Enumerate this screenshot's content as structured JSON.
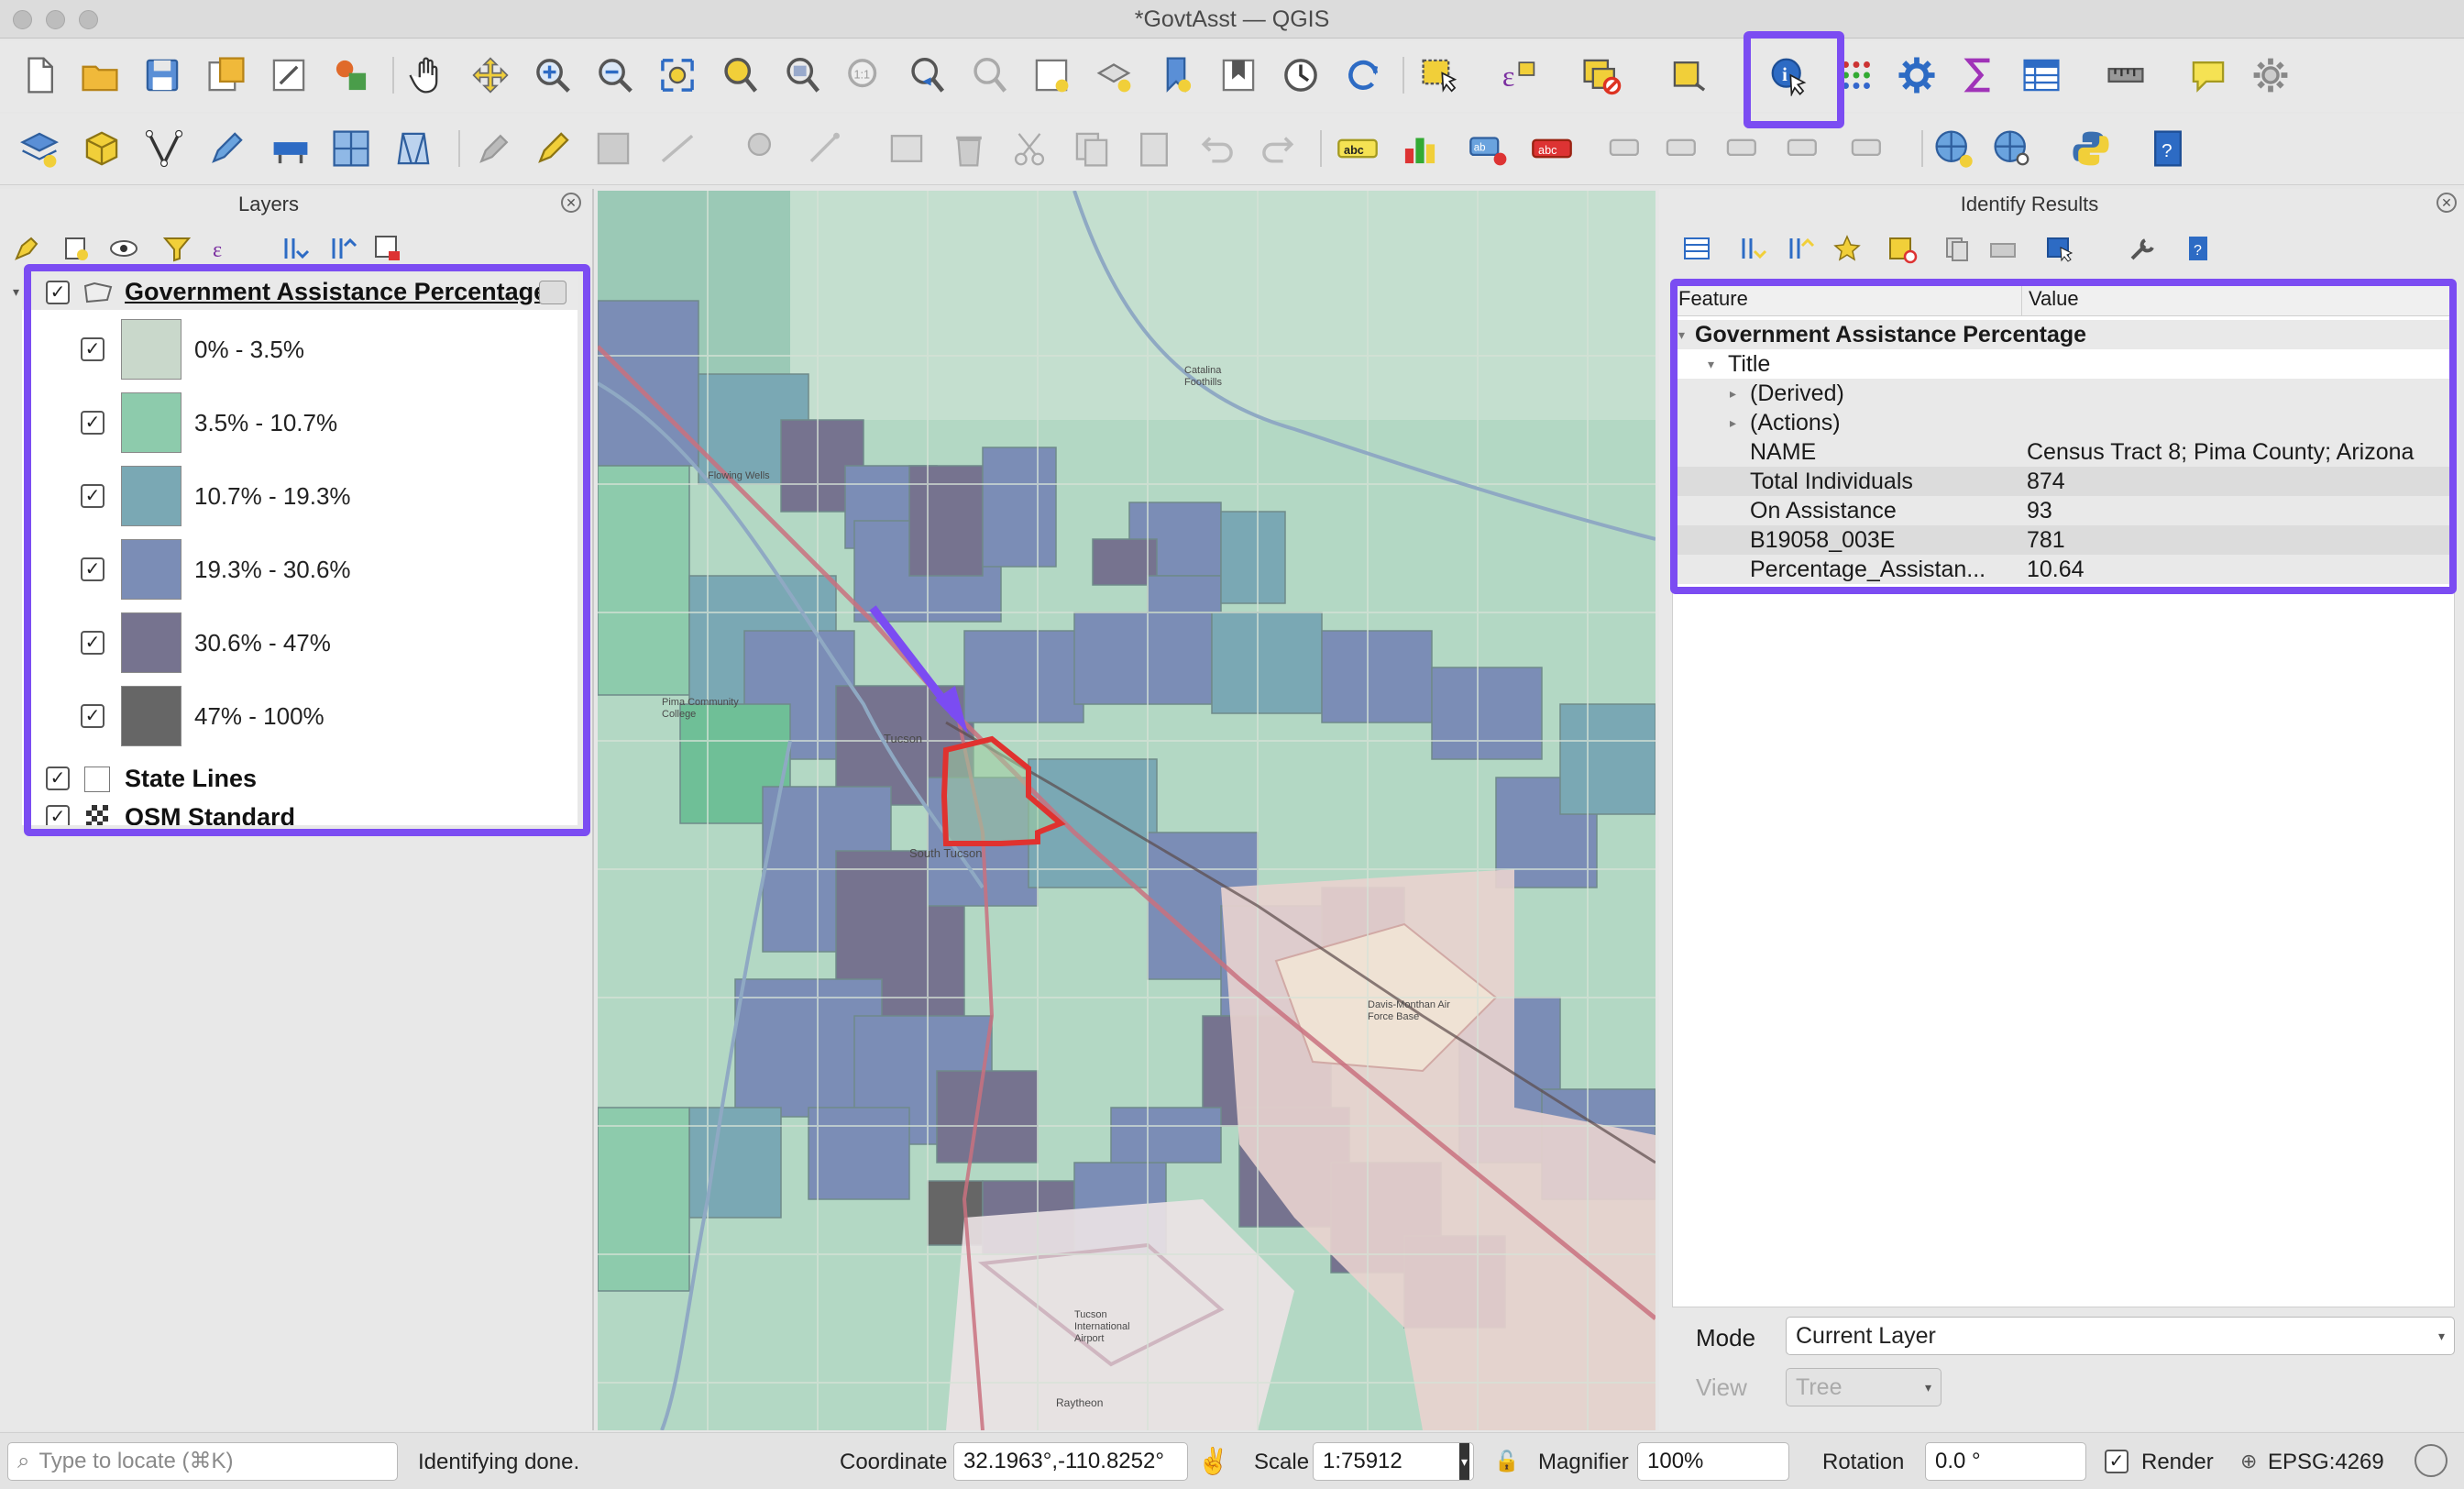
{
  "window": {
    "title": "*GovtAsst — QGIS"
  },
  "layers_panel": {
    "title": "Layers",
    "layers": [
      {
        "name": "Government Assistance Percentage",
        "checked": true,
        "legend": [
          {
            "label": "0% - 3.5%",
            "color": "#c9d8cb"
          },
          {
            "label": "3.5% - 10.7%",
            "color": "#8dcbac"
          },
          {
            "label": "10.7% - 19.3%",
            "color": "#7aa8b4"
          },
          {
            "label": "19.3% - 30.6%",
            "color": "#7b8db6"
          },
          {
            "label": "30.6% - 47%",
            "color": "#76738f"
          },
          {
            "label": "47% - 100%",
            "color": "#666666"
          }
        ]
      },
      {
        "name": "State Lines",
        "checked": true
      },
      {
        "name": "OSM Standard",
        "checked": true
      }
    ]
  },
  "map": {
    "labels": [
      "Tucson",
      "South Tucson",
      "Pima Community College",
      "Davis-Monthan Air Force Base",
      "Tucson International Airport",
      "Raytheon",
      "Catalina Foothills",
      "Flowing Wells"
    ]
  },
  "identify_panel": {
    "title": "Identify Results",
    "col_feature": "Feature",
    "col_value": "Value",
    "layer": "Government Assistance Percentage",
    "title_node": "Title",
    "derived": "(Derived)",
    "actions": "(Actions)",
    "attributes": [
      {
        "key": "NAME",
        "value": "Census Tract 8; Pima County; Arizona"
      },
      {
        "key": "Total Individuals",
        "value": "874"
      },
      {
        "key": "On Assistance",
        "value": "93"
      },
      {
        "key": "B19058_003E",
        "value": "781"
      },
      {
        "key": "Percentage_Assistan...",
        "value": "10.64"
      }
    ],
    "mode_label": "Mode",
    "mode_value": "Current Layer",
    "view_label": "View",
    "view_value": "Tree"
  },
  "statusbar": {
    "locate_placeholder": "Type to locate (⌘K)",
    "message": "Identifying done.",
    "coordinate_label": "Coordinate",
    "coordinate_value": "32.1963°,-110.8252°",
    "scale_label": "Scale",
    "scale_value": "1:75912",
    "magnifier_label": "Magnifier",
    "magnifier_value": "100%",
    "rotation_label": "Rotation",
    "rotation_value": "0.0 °",
    "render_label": "Render",
    "crs": "EPSG:4269"
  },
  "colors": {
    "highlight": "#7b4cf2",
    "selected_feature": "#e0322f",
    "tract_fill": "#8dcbac"
  }
}
